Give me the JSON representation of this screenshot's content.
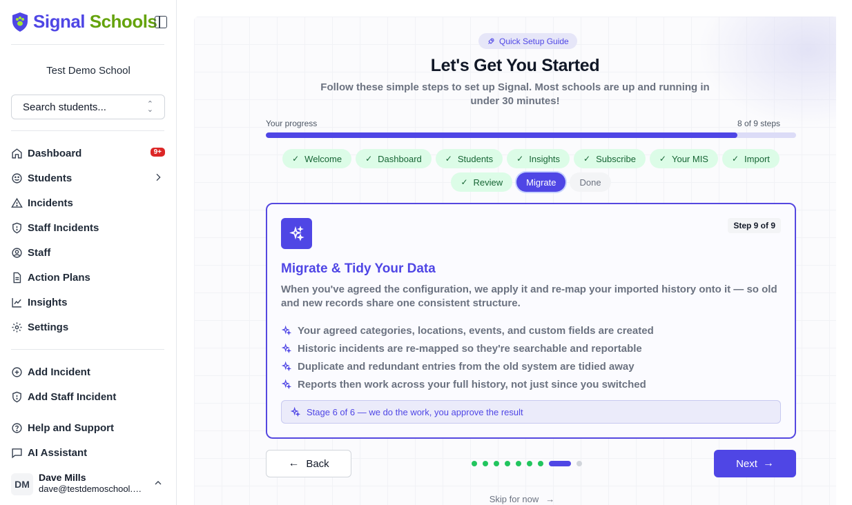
{
  "sidebar": {
    "brand_part1": "Signal",
    "brand_part2": "Schools",
    "school_name": "Test Demo School",
    "search_placeholder": "Search students...",
    "nav": [
      {
        "label": "Dashboard",
        "badge": "9+"
      },
      {
        "label": "Students"
      },
      {
        "label": "Incidents"
      },
      {
        "label": "Staff Incidents"
      },
      {
        "label": "Staff"
      },
      {
        "label": "Action Plans"
      },
      {
        "label": "Insights"
      },
      {
        "label": "Settings"
      }
    ],
    "actions": [
      {
        "label": "Add Incident"
      },
      {
        "label": "Add Staff Incident"
      }
    ],
    "support": [
      {
        "label": "Help and Support"
      },
      {
        "label": "AI Assistant"
      }
    ],
    "user": {
      "initials": "DM",
      "name": "Dave Mills",
      "email": "dave@testdemoschool.com"
    }
  },
  "guide": {
    "pill": "Quick Setup Guide",
    "title": "Let's Get You Started",
    "subtitle": "Follow these simple steps to set up Signal. Most schools are up and running in under 30 minutes!",
    "progress_label": "Your progress",
    "progress_count": "8 of 9 steps",
    "progress_fraction": 0.889,
    "steps": [
      {
        "label": "Welcome",
        "state": "done"
      },
      {
        "label": "Dashboard",
        "state": "done"
      },
      {
        "label": "Students",
        "state": "done"
      },
      {
        "label": "Insights",
        "state": "done"
      },
      {
        "label": "Subscribe",
        "state": "done"
      },
      {
        "label": "Your MIS",
        "state": "done"
      },
      {
        "label": "Import",
        "state": "done"
      },
      {
        "label": "Review",
        "state": "done"
      },
      {
        "label": "Migrate",
        "state": "current"
      },
      {
        "label": "Done",
        "state": "todo"
      }
    ]
  },
  "card": {
    "step_badge": "Step 9 of 9",
    "title": "Migrate & Tidy Your Data",
    "description": "When you've agreed the configuration, we apply it and re-map your imported history onto it — so old and new records share one consistent structure.",
    "bullets": [
      "Your agreed categories, locations, events, and custom fields are created",
      "Historic incidents are re-mapped so they're searchable and reportable",
      "Duplicate and redundant entries from the old system are tidied away",
      "Reports then work across your full history, not just since you switched"
    ],
    "stage_note": "Stage 6 of 6 — we do the work, you approve the result"
  },
  "footer": {
    "back_label": "Back",
    "next_label": "Next",
    "skip_label": "Skip for now",
    "dots_done": 8,
    "dots_total": 9
  },
  "colors": {
    "accent": "#4f46e5",
    "success": "#22c55e",
    "brand_green": "#65a30d",
    "danger": "#dc2626"
  }
}
